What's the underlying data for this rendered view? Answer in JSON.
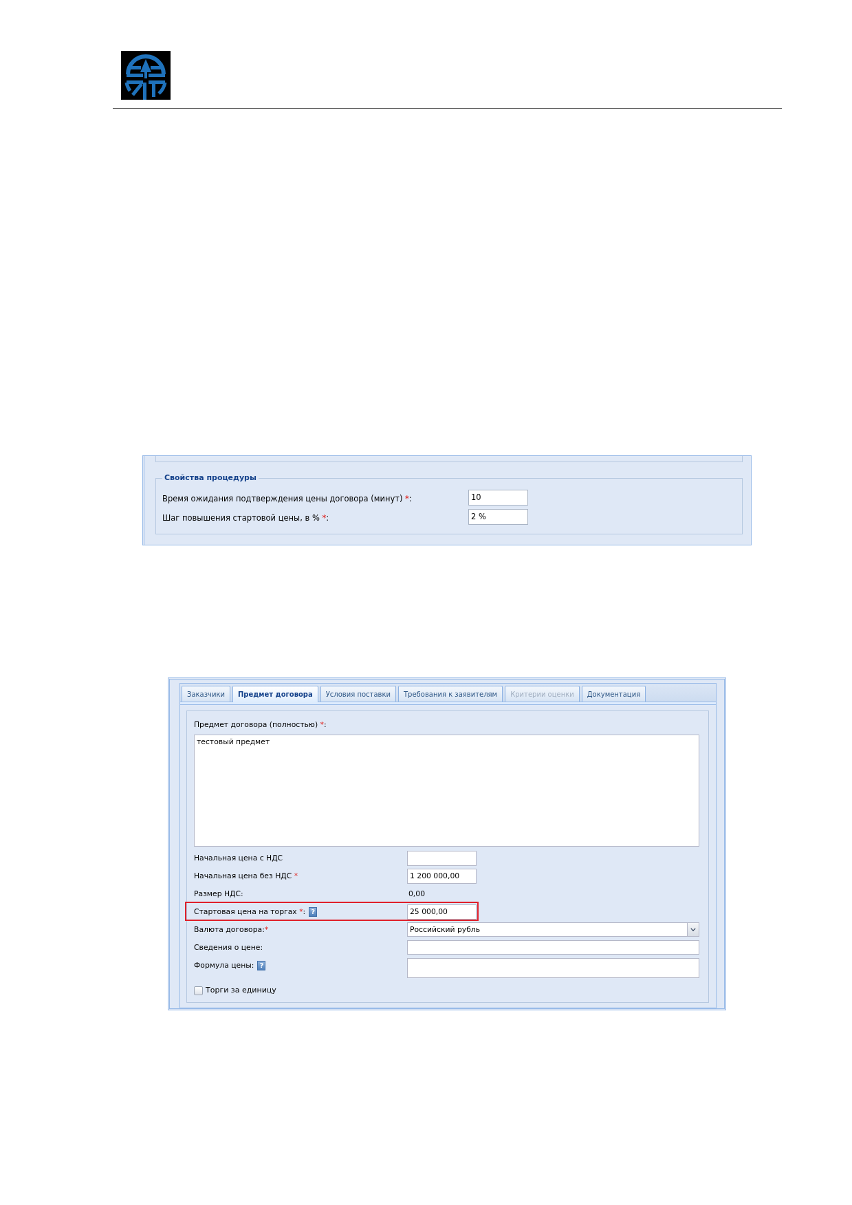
{
  "procedure_properties": {
    "legend": "Свойства процедуры",
    "fields": [
      {
        "label": "Время ожидания подтверждения цены договора (минут) ",
        "required_mark": "*",
        "label_end": ":",
        "value": "10"
      },
      {
        "label": "Шаг повышения стартовой цены, в % ",
        "required_mark": "*",
        "label_end": ":",
        "value": "2 %"
      }
    ]
  },
  "contract_form": {
    "tabs": [
      {
        "label": "Заказчики",
        "selected": false,
        "disabled": false
      },
      {
        "label": "Предмет договора",
        "selected": true,
        "disabled": false
      },
      {
        "label": "Условия поставки",
        "selected": false,
        "disabled": false
      },
      {
        "label": "Требования к заявителям",
        "selected": false,
        "disabled": false
      },
      {
        "label": "Критерии оценки",
        "selected": false,
        "disabled": true
      },
      {
        "label": "Документация",
        "selected": false,
        "disabled": false
      }
    ],
    "subject": {
      "label": "Предмет договора (полностью) ",
      "required_mark": "*",
      "label_end": ":",
      "value": "тестовый предмет"
    },
    "fields": [
      {
        "kind": "short",
        "label": "Начальная цена с НДС",
        "highlighted": false
      },
      {
        "kind": "short",
        "label": "Начальная цена без НДС ",
        "required_mark": "*",
        "value": "1 200 000,00",
        "highlighted": false
      },
      {
        "kind": "readout",
        "label": "Размер НДС:",
        "value": "0,00",
        "highlighted": false
      },
      {
        "kind": "short",
        "label": "Стартовая цена на торгах ",
        "required_mark": "*",
        "label_end": ":",
        "help_icon": "?",
        "value": "25 000,00",
        "highlighted": true
      },
      {
        "kind": "dropdown",
        "label": "Валюта договора:",
        "required_mark": "*",
        "value": "Российский рубль",
        "highlighted": false
      },
      {
        "kind": "wide",
        "label": "Сведения о цене:",
        "highlighted": false
      },
      {
        "kind": "multiline",
        "label": "Формула цены:",
        "help_icon": "?",
        "highlighted": false
      }
    ],
    "checkbox": {
      "label": "Торги за единицу",
      "checked": false
    }
  }
}
